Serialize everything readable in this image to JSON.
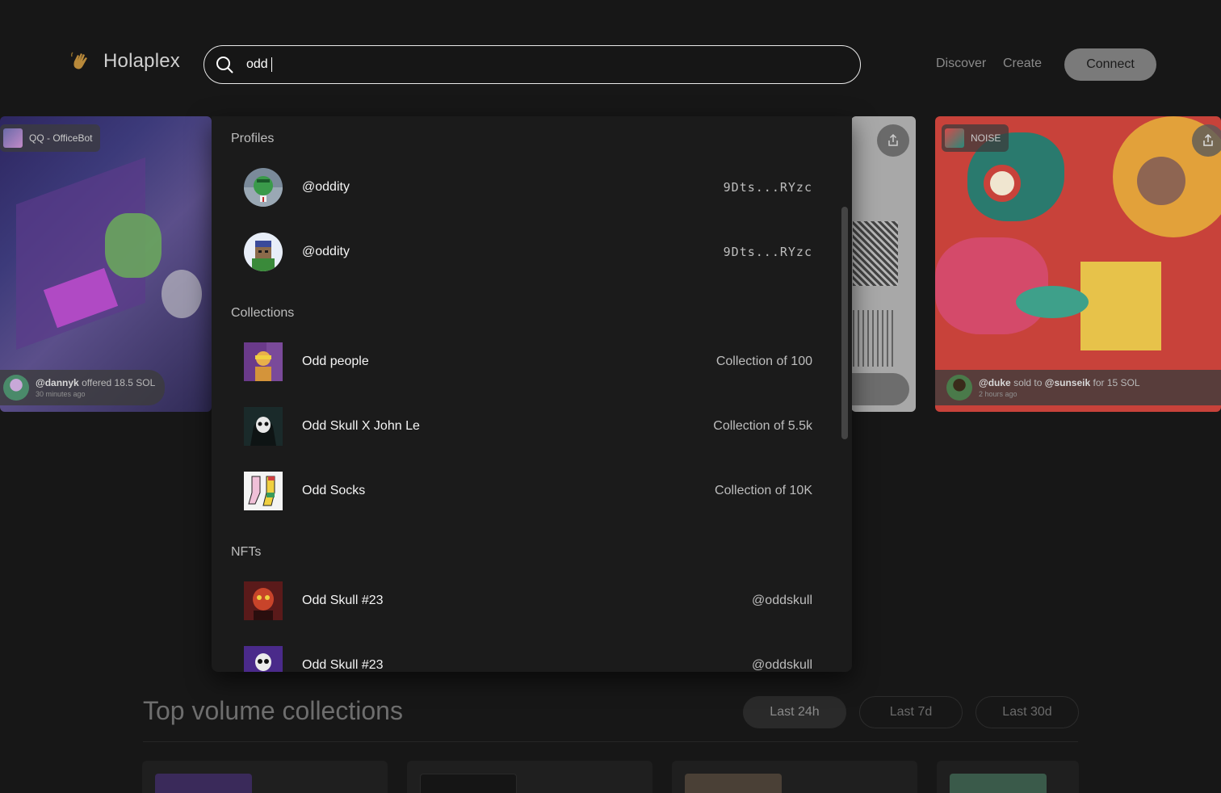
{
  "header": {
    "brand": "Holaplex",
    "search_value": "odd",
    "nav": [
      "Discover",
      "Create"
    ],
    "connect_label": "Connect"
  },
  "background_cards": {
    "left": {
      "tag": "QQ - OfficeBot",
      "user": "@dannyk",
      "action": "offered 18.5 SOL",
      "time": "30 minutes ago"
    },
    "right": {
      "tag": "NOISE",
      "seller": "@duke",
      "mid": "sold to",
      "buyer": "@sunseik",
      "suffix": "for 15 SOL",
      "time": "2 hours ago"
    }
  },
  "dropdown": {
    "sections": {
      "profiles": "Profiles",
      "collections": "Collections",
      "nfts": "NFTs"
    },
    "profiles": [
      {
        "name": "@oddity",
        "address": "9Dts...RYzc"
      },
      {
        "name": "@oddity",
        "address": "9Dts...RYzc"
      }
    ],
    "collections": [
      {
        "name": "Odd people",
        "meta": "Collection of 100"
      },
      {
        "name": "Odd Skull X John Le",
        "meta": "Collection of 5.5k"
      },
      {
        "name": "Odd Socks",
        "meta": "Collection of 10K"
      }
    ],
    "nfts": [
      {
        "name": "Odd Skull #23",
        "owner": "@oddskull"
      },
      {
        "name": "Odd Skull #23",
        "owner": "@oddskull"
      }
    ]
  },
  "top_volume": {
    "title": "Top volume collections",
    "filters": [
      "Last 24h",
      "Last 7d",
      "Last 30d"
    ],
    "active_filter": "Last 24h"
  },
  "colors": {
    "background": "#171717",
    "dropdown": "#1b1b1b",
    "connect_button": "#7a7a7a"
  }
}
